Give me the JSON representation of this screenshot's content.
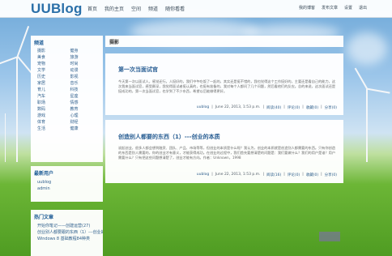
{
  "header": {
    "logo": "UUBlog",
    "nav": [
      "首页",
      "我的主页",
      "空间",
      "频道",
      "随你看看"
    ],
    "user_links": [
      "我的博客",
      "发布文章",
      "设置",
      "退出"
    ]
  },
  "sidebar": {
    "categories": {
      "title": "频道",
      "items": [
        "摄影",
        "健身",
        "美食",
        "旅游",
        "宠物",
        "时尚",
        "文学",
        "动漫",
        "历史",
        "影视",
        "家居",
        "音乐",
        "育儿",
        "科技",
        "汽车",
        "星座",
        "职场",
        "情感",
        "数码",
        "教育",
        "游戏",
        "心理",
        "体育",
        "财经",
        "生活",
        "健康"
      ]
    },
    "latest_users": {
      "title": "最新用户",
      "items": [
        "uublog",
        "admin"
      ]
    },
    "hot_posts": {
      "title": "热门文章",
      "items": [
        "开始你笔记——创建运营(27)",
        "创业别人都要跟的东西（1）---创业的本质",
        "Windows 8 基础教程84种类"
      ]
    }
  },
  "main": {
    "section_title": "摄影",
    "posts": [
      {
        "title": "第一次当面试官",
        "body": "今天第一次以面试人，感觉还行。人挺好的，我们中午吃饭了一起的，其实还是挺不错的，我也觉得这个工作挺好的，主要还是看自己的能力，这次我来当面试官，感受颇深，我觉得面试者挺认真的，也挺有准备的，我对每个人都问了几个问题，然后看他们的反应。总的来说，这次面试还是挺成功的，第一次当面试官，也学到了不少东西，希望以后能做得更好。",
        "author": "uublog",
        "date": "June 22, 2013, 1:53 p.m.",
        "reads": "阅读(40)",
        "comments": "评论(0)",
        "likes": "收藏(0)",
        "share": "分享(0)"
      },
      {
        "title": "创造别人都要的东西（1）---创业的本质",
        "body": "说起创业，很多人都会想到融资、团队、产品、市场等等，但创业的本质是什么呢？我认为，创业的本质就是创造别人都需要的东西。只有你创造的东西是别人需要的，你的创业才有意义，才能获得成功。在创业的过程中，我们首先要想清楚的问题是：我们要做什么？我们的用户是谁？用户需要什么？只有把这些问题想清楚了，创业才能有方向。作者：Unknown，1998",
        "author": "uublog",
        "date": "June 22, 2013, 1:53 p.m.",
        "reads": "阅读(16)",
        "comments": "评论(0)",
        "likes": "收藏(0)",
        "share": "分享(0)"
      }
    ]
  },
  "colors": {
    "logo": "#2a6fa8",
    "link": "#2f5f8c",
    "title": "#2a5f94"
  }
}
